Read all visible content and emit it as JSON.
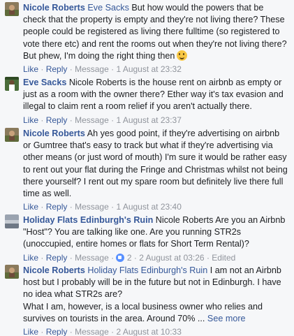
{
  "comments": [
    {
      "author": "Nicole Roberts",
      "mention": "Eve Sacks",
      "text": " But how would the powers that be check that the property is empty and they're not living there? These people could be registered as living there fulltime (so registered to vote there etc) and rent the rooms out when they're not living there?\nBut phew, I'm doing the right thing then",
      "like": "Like",
      "reply": "Reply",
      "message": "Message",
      "timestamp": "1 August at 23:32",
      "emoji": "smiling-face"
    },
    {
      "author": "Eve Sacks",
      "mention": "",
      "text": " Nicole Roberts is the house rent on airbnb as empty or just as a room with the owner there? Ether way it's tax evasion and illegal to claim rent a room relief if you aren't actually there.",
      "like": "Like",
      "reply": "Reply",
      "message": "Message",
      "timestamp": "1 August at 23:37"
    },
    {
      "author": "Nicole Roberts",
      "mention": "",
      "text": " Ah yes good point, if they're advertising on airbnb or Gumtree that's easy to track but what if they're advertising via other means (or just word of mouth) I'm sure it would be rather easy to rent out your flat during the Fringe and Christmas whilst not being there yourself? I rent out my spare room but definitely live there full time as well.",
      "like": "Like",
      "reply": "Reply",
      "message": "Message",
      "timestamp": "1 August at 23:40"
    },
    {
      "author": "Holiday Flats Edinburgh's Ruin",
      "mention": "",
      "text": " Nicole Roberts Are you an Airbnb \"Host\"? You are talking like one. Are you running STR2s (unoccupied, entire homes or flats for Short Term Rental)?",
      "like": "Like",
      "reply": "Reply",
      "message": "Message",
      "reaction_count": "2",
      "timestamp": "2 August at 03:26",
      "edited": "Edited"
    },
    {
      "author": "Nicole Roberts",
      "mention": "Holiday Flats Edinburgh's Ruin",
      "text": " I am not an Airbnb host but I probably will be in the future but not in Edinburgh. I have no idea what STR2s are?\nWhat I am, however, is a local business owner who relies and survives on tourists in the area. Around 70% ...",
      "see_more": "See more",
      "like": "Like",
      "reply": "Reply",
      "message": "Message",
      "timestamp": "2 August at 10:33"
    }
  ],
  "colors": {
    "link": "#365899",
    "meta": "#90949c",
    "background": "#f6f7f9"
  }
}
